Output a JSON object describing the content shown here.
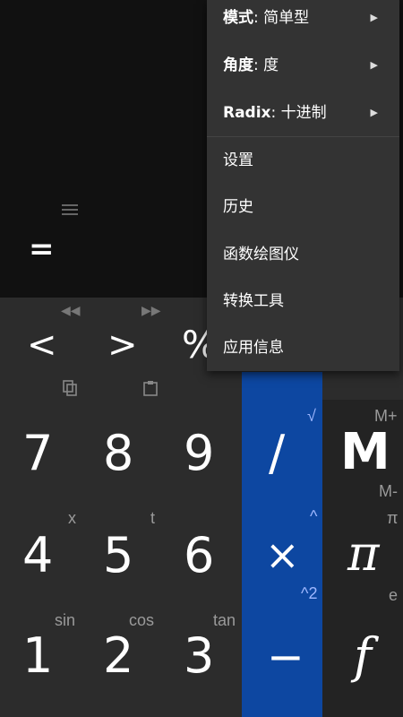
{
  "display": {
    "equals": "="
  },
  "keypad": {
    "row1": {
      "left_arrow": "<",
      "right_arrow": ">",
      "percent": "%"
    },
    "digits": [
      "7",
      "8",
      "9",
      "4",
      "5",
      "6",
      "1",
      "2",
      "3"
    ],
    "ops": {
      "divide": "/",
      "multiply": "×",
      "minus": "−"
    },
    "right": {
      "memory": "M",
      "pi": "π",
      "function": "f"
    },
    "small": {
      "sqrt": "√",
      "mplus": "M+",
      "mminus": "M-",
      "x": "x",
      "t": "t",
      "caret": "^",
      "pi_small": "π",
      "caret2": "^2",
      "e": "e",
      "sin": "sin",
      "cos": "cos",
      "tan": "tan"
    }
  },
  "popup": {
    "mode": {
      "label": "模式",
      "value": "简单型"
    },
    "angle": {
      "label": "角度",
      "value": "度"
    },
    "radix": {
      "label": "Radix",
      "value": "十进制"
    },
    "items": [
      "设置",
      "历史",
      "函数绘图仪",
      "转换工具",
      "应用信息"
    ]
  }
}
